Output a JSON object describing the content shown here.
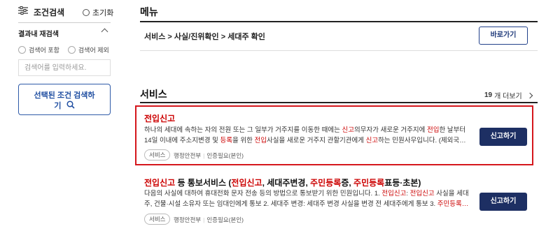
{
  "filter": {
    "title": "조건검색",
    "reset_label": "초기화",
    "within_title": "결과내 재검색",
    "include_label": "검색어 포함",
    "exclude_label": "검색어 제외",
    "search_placeholder": "검색어를 입력하세요.",
    "apply_line1": "선택된 조건 검색하",
    "apply_line2": "기"
  },
  "menu": {
    "title": "메뉴",
    "breadcrumb": "서비스 > 사실/진위확인 > 세대주 확인",
    "go_label": "바로가기"
  },
  "services": {
    "title": "서비스",
    "count": "19",
    "more_label": "개 더보기",
    "items": [
      {
        "title": "전입신고",
        "desc_line1_a": "하나의 세대에 속하는 자의 전원 또는 그 일부가 거주지를 이동한 때에는 ",
        "desc_line1_b": "신고",
        "desc_line1_c": "의무자가 새로운 거주지에 ",
        "desc_line1_d": "전입",
        "desc_line1_e": "한 날부터",
        "desc_line2_a": "14일 이내에 주소지변경 및 ",
        "desc_line2_b": "등록",
        "desc_line2_c": "을 위한 ",
        "desc_line2_d": "전입",
        "desc_line2_e": "사실을 새로운 거주지 관할기관에게 ",
        "desc_line2_f": "신고",
        "desc_line2_g": "하는 민원사무입니다. (제외국…",
        "tag": "서비스",
        "agency": "행정안전부",
        "auth": "인증필요(본인)",
        "button": "신고하기"
      },
      {
        "title_a": "전입신고",
        "title_b": " 등 통보서비스 (",
        "title_c": "전입신고",
        "title_d": ", 세대주변경, ",
        "title_e": "주민등록",
        "title_f": "증, ",
        "title_g": "주민등록",
        "title_h": "표등·초본)",
        "desc_line1_a": "다음의 사실에 대하여 휴대전화 문자 전송 등의 방법으로 통보받기 위한 민원입니다. 1. ",
        "desc_line1_b": "전입신고",
        "desc_line1_c": ": ",
        "desc_line1_d": "전입신고",
        "desc_line1_e": " 사실을 세대",
        "desc_line2_a": "주, 건물·시설 소유자 또는 임대인에게 통보 2. 세대주 변경: 세대주 변경 사실을 변경 전 세대주에게 통보 3. ",
        "desc_line2_b": "주민등록…",
        "tag": "서비스",
        "agency": "행정안전부",
        "auth": "인증필요(본인)",
        "button": "신고하기"
      }
    ]
  }
}
